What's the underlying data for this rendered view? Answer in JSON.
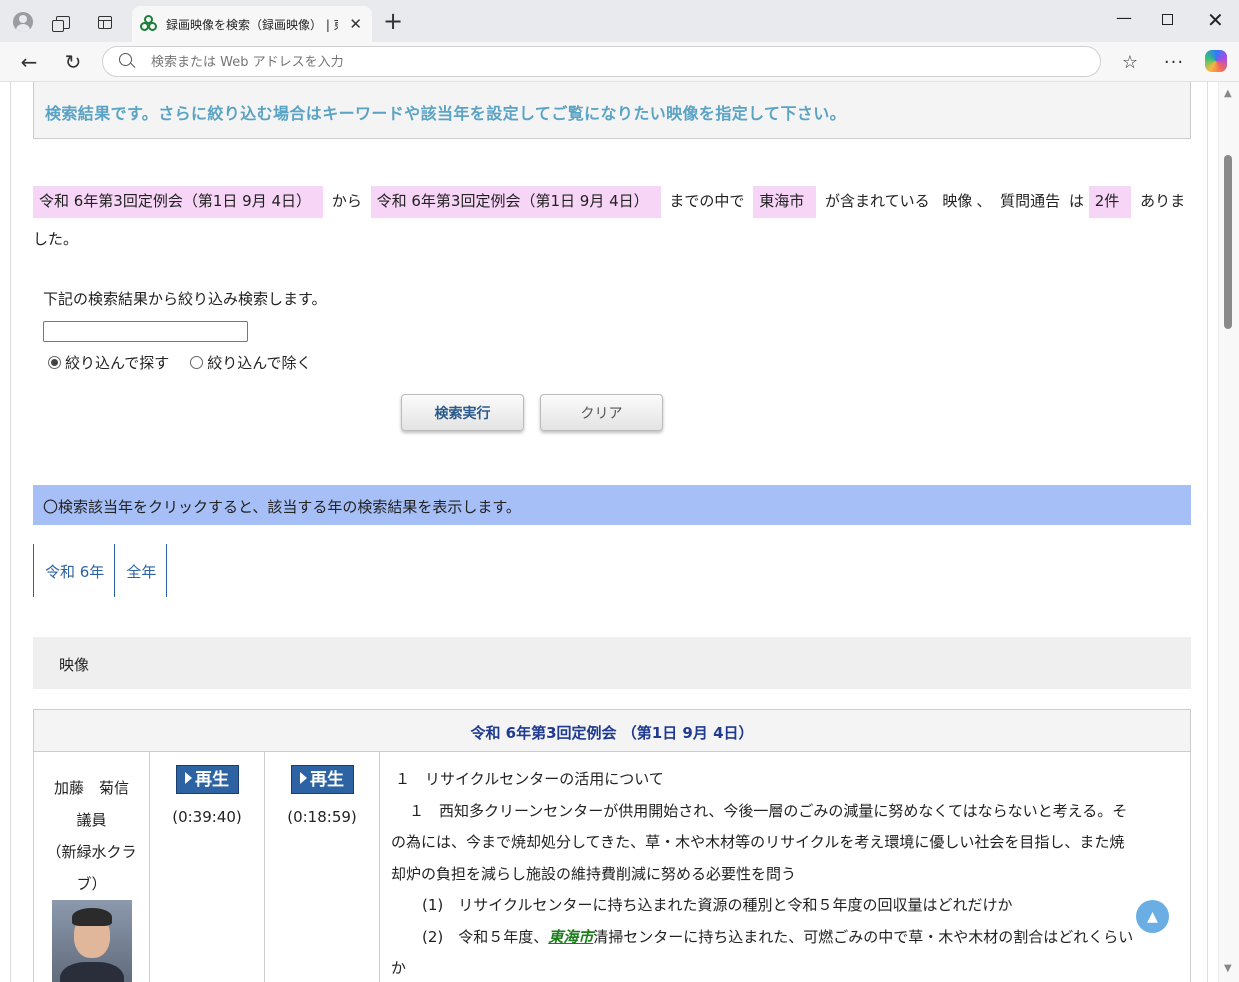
{
  "browser": {
    "tab_title": "録画映像を検索（録画映像） | 東海",
    "address_placeholder": "検索または Web アドレスを入力"
  },
  "page": {
    "notice": "検索結果です。さらに絞り込む場合はキーワードや該当年を設定してご覧になりたい映像を指定して下さい。",
    "summary": {
      "from": "令和 6年第3回定例会（第1日 9月 4日）",
      "kara": "から",
      "to": "令和 6年第3回定例会（第1日 9月 4日）",
      "made": "までの中で",
      "keyword": "東海市",
      "contains": "が含まれている",
      "type1": "映像",
      "sep": "、",
      "type2": "質問通告",
      "wa": "は",
      "count": "2件",
      "end": "ありました。"
    },
    "refine": {
      "label": "下記の検索結果から絞り込み検索します。",
      "input_value": "",
      "radio_include": "絞り込んで探す",
      "radio_exclude": "絞り込んで除く",
      "selected": "include",
      "search_button": "検索実行",
      "clear_button": "クリア"
    },
    "year_note": "〇検索該当年をクリックすると、該当する年の検索結果を表示します。",
    "year_tabs": [
      "令和 6年",
      "全年"
    ],
    "section_title": "映像",
    "result": {
      "session": "令和 6年第3回定例会 （第1日 9月 4日）",
      "speaker_name": "加藤　菊信",
      "speaker_role": "議員",
      "speaker_party_1": "（新緑水クラ",
      "speaker_party_2": "ブ）",
      "play_label": "再生",
      "duration_1": "(0:39:40)",
      "duration_2": "(0:18:59)",
      "text_l1": "１　リサイクルセンターの活用について",
      "text_l2a": "１　西知多クリーンセンターが供用開始され、今後一層のごみの減量に努めなくてはならないと考える。そ",
      "text_l2b": "の為には、今まで焼却処分してきた、草・木や木材等のリサイクルを考え環境に優しい社会を目指し、また焼",
      "text_l2c": "却炉の負担を減らし施設の維持費削減に努める必要性を問う",
      "text_l3": "(1)　リサイクルセンターに持ち込まれた資源の種別と令和５年度の回収量はどれだけか",
      "text_l4_pre": "(2)　令和５年度、",
      "text_l4_kw": "東海市",
      "text_l4_post": "清掃センターに持ち込まれた、可燃ごみの中で草・木や木材の割合はどれくらい",
      "text_l4_end": "か"
    }
  }
}
